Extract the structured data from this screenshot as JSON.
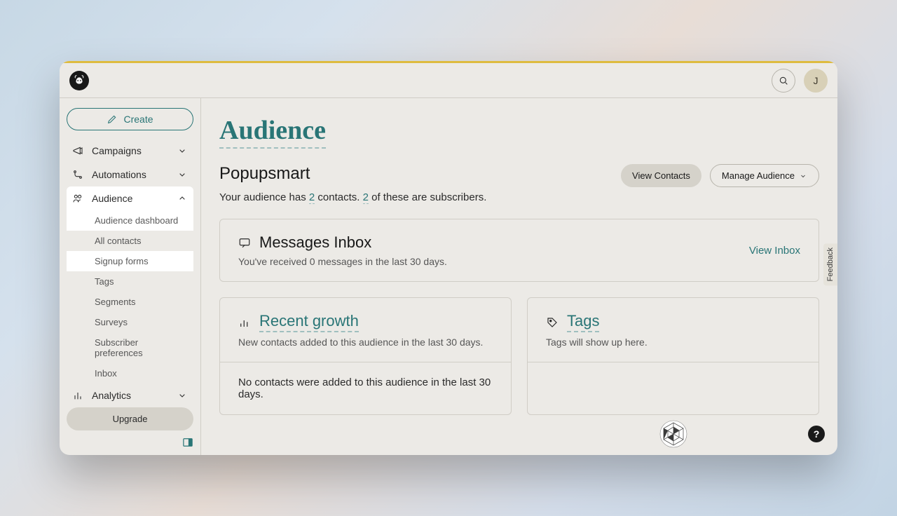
{
  "topbar": {
    "avatar_initial": "J"
  },
  "sidebar": {
    "create_label": "Create",
    "items": {
      "campaigns": "Campaigns",
      "automations": "Automations",
      "audience": "Audience",
      "analytics": "Analytics"
    },
    "audience_sub": {
      "dashboard": "Audience dashboard",
      "all_contacts": "All contacts",
      "signup_forms": "Signup forms",
      "tags": "Tags",
      "segments": "Segments",
      "surveys": "Surveys",
      "subscriber_prefs": "Subscriber preferences",
      "inbox": "Inbox"
    },
    "upgrade_label": "Upgrade"
  },
  "main": {
    "page_title": "Audience",
    "audience_name": "Popupsmart",
    "view_contacts_label": "View Contacts",
    "manage_audience_label": "Manage Audience",
    "summary_prefix": "Your audience has ",
    "contacts_count": "2",
    "summary_mid": " contacts. ",
    "subscribers_count": "2",
    "summary_suffix": " of these are subscribers.",
    "inbox": {
      "title": "Messages Inbox",
      "sub": "You've received 0 messages in the last 30 days.",
      "view_label": "View Inbox"
    },
    "recent_growth": {
      "title": "Recent growth",
      "sub": "New contacts added to this audience in the last 30 days.",
      "body": "No contacts were added to this audience in the last 30 days."
    },
    "tags": {
      "title": "Tags",
      "sub": "Tags will show up here."
    },
    "feedback_label": "Feedback",
    "help_label": "?"
  }
}
